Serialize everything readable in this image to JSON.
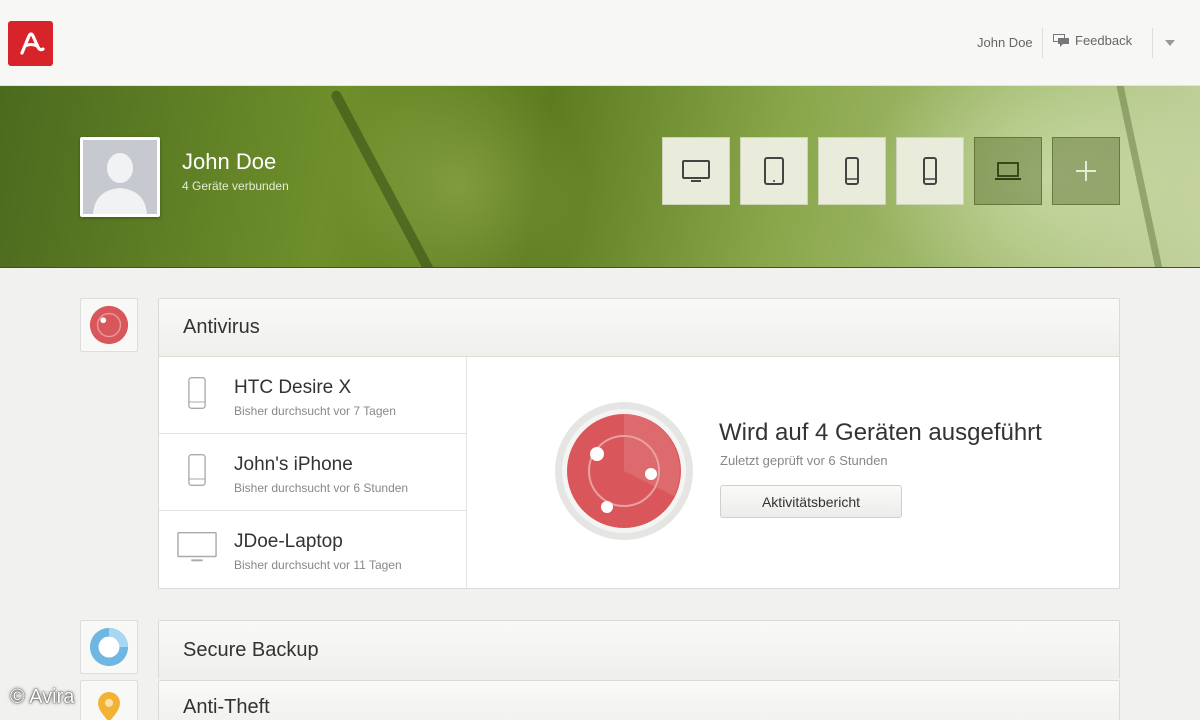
{
  "header": {
    "user_name": "John Doe",
    "feedback_label": "Feedback",
    "logo_icon": "avira-logo-icon",
    "brand_color": "#d7242a"
  },
  "profile": {
    "name": "John Doe",
    "subtitle": "4 Geräte verbunden",
    "devices": [
      {
        "icon": "monitor-icon",
        "active": true
      },
      {
        "icon": "tablet-icon",
        "active": true
      },
      {
        "icon": "phone-icon",
        "active": true
      },
      {
        "icon": "phone-icon",
        "active": true
      },
      {
        "icon": "laptop-icon",
        "active": false
      },
      {
        "icon": "plus-icon",
        "active": false
      }
    ]
  },
  "antivirus": {
    "title": "Antivirus",
    "devices": [
      {
        "name": "HTC Desire X",
        "status": "Bisher durchsucht vor 7 Tagen",
        "icon": "phone-icon"
      },
      {
        "name": "John's iPhone",
        "status": "Bisher durchsucht vor 6 Stunden",
        "icon": "phone-icon"
      },
      {
        "name": "JDoe-Laptop",
        "status": "Bisher durchsucht vor 11 Tagen",
        "icon": "monitor-icon"
      }
    ],
    "status_title": "Wird auf 4 Geräten ausgeführt",
    "status_sub": "Zuletzt geprüft vor 6 Stunden",
    "report_button": "Aktivitätsbericht",
    "accent_color": "#d9575a"
  },
  "secure_backup": {
    "title": "Secure Backup",
    "accent_color": "#6fb6e3"
  },
  "anti_theft": {
    "title": "Anti-Theft",
    "accent_color": "#f2b233"
  },
  "watermark": "© Avira"
}
